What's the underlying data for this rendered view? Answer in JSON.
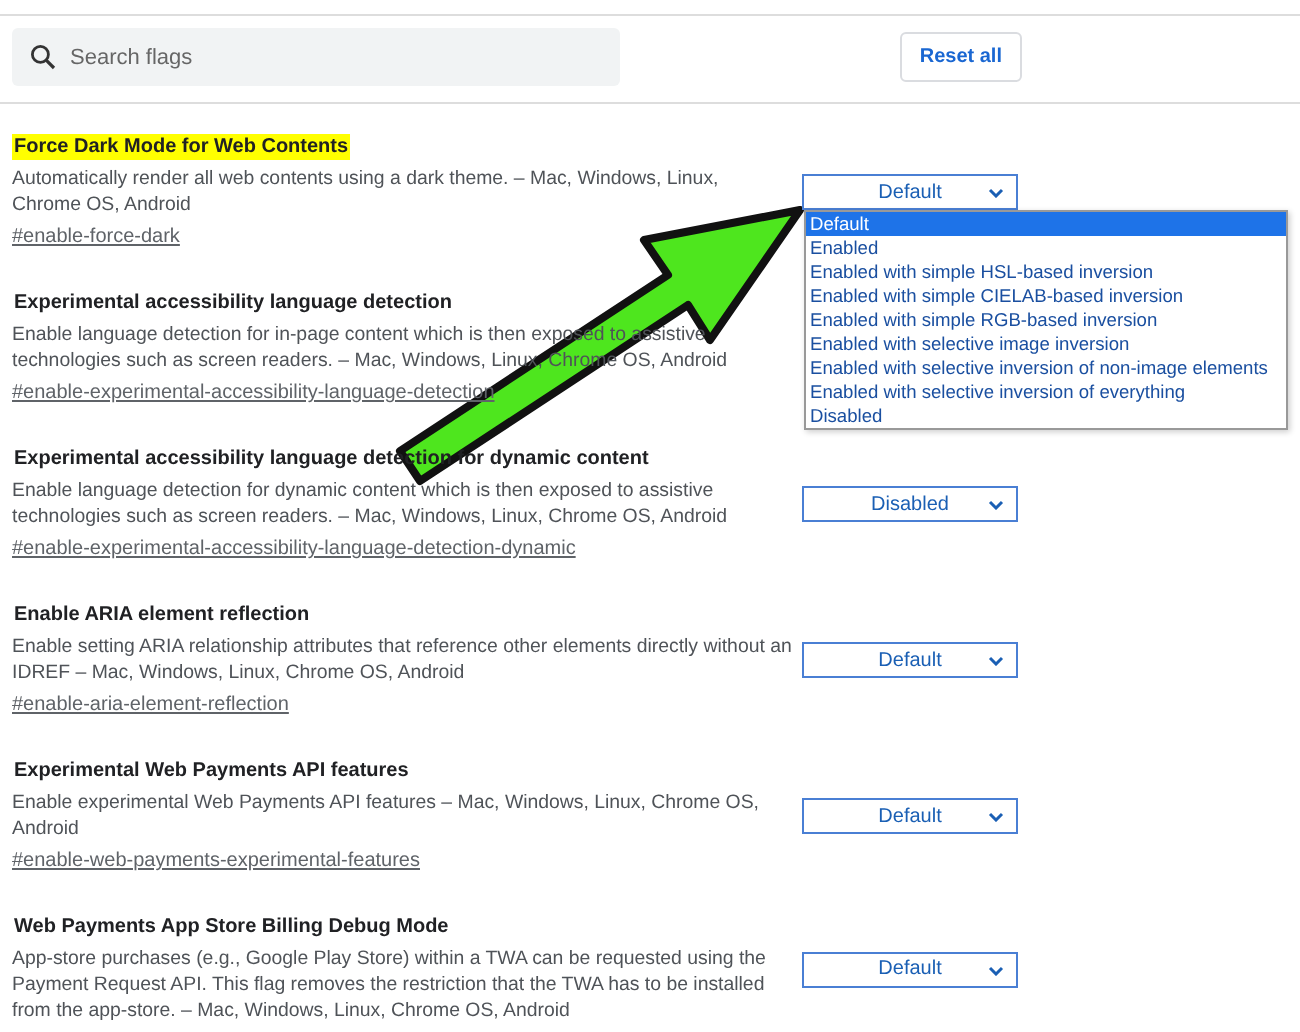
{
  "search": {
    "placeholder": "Search flags"
  },
  "reset_button": "Reset all",
  "flags": [
    {
      "title": "Force Dark Mode for Web Contents",
      "highlighted": true,
      "description": "Automatically render all web contents using a dark theme. – Mac, Windows, Linux, Chrome OS, Android",
      "tag": "#enable-force-dark",
      "value": "Default",
      "options": [
        {
          "label": "Default",
          "selected": true
        },
        {
          "label": "Enabled",
          "selected": false
        },
        {
          "label": "Enabled with simple HSL-based inversion",
          "selected": false
        },
        {
          "label": "Enabled with simple CIELAB-based inversion",
          "selected": false
        },
        {
          "label": "Enabled with simple RGB-based inversion",
          "selected": false
        },
        {
          "label": "Enabled with selective image inversion",
          "selected": false
        },
        {
          "label": "Enabled with selective inversion of non-image elements",
          "selected": false
        },
        {
          "label": "Enabled with selective inversion of everything",
          "selected": false
        },
        {
          "label": "Disabled",
          "selected": false
        }
      ]
    },
    {
      "title": "Experimental accessibility language detection",
      "highlighted": false,
      "description": "Enable language detection for in-page content which is then exposed to assistive technologies such as screen readers. – Mac, Windows, Linux, Chrome OS, Android",
      "tag": "#enable-experimental-accessibility-language-detection"
    },
    {
      "title": "Experimental accessibility language detection for dynamic content",
      "highlighted": false,
      "description": "Enable language detection for dynamic content which is then exposed to assistive technologies such as screen readers. – Mac, Windows, Linux, Chrome OS, Android",
      "tag": "#enable-experimental-accessibility-language-detection-dynamic",
      "value": "Disabled"
    },
    {
      "title": "Enable ARIA element reflection",
      "highlighted": false,
      "description": "Enable setting ARIA relationship attributes that reference other elements directly without an IDREF – Mac, Windows, Linux, Chrome OS, Android",
      "tag": "#enable-aria-element-reflection",
      "value": "Default"
    },
    {
      "title": "Experimental Web Payments API features",
      "highlighted": false,
      "description": "Enable experimental Web Payments API features – Mac, Windows, Linux, Chrome OS, Android",
      "tag": "#enable-web-payments-experimental-features",
      "value": "Default"
    },
    {
      "title": "Web Payments App Store Billing Debug Mode",
      "highlighted": false,
      "description": "App-store purchases (e.g., Google Play Store) within a TWA can be requested using the Payment Request API. This flag removes the restriction that the TWA has to be installed from the app-store. – Mac, Windows, Linux, Chrome OS, Android",
      "value": "Default"
    }
  ]
}
